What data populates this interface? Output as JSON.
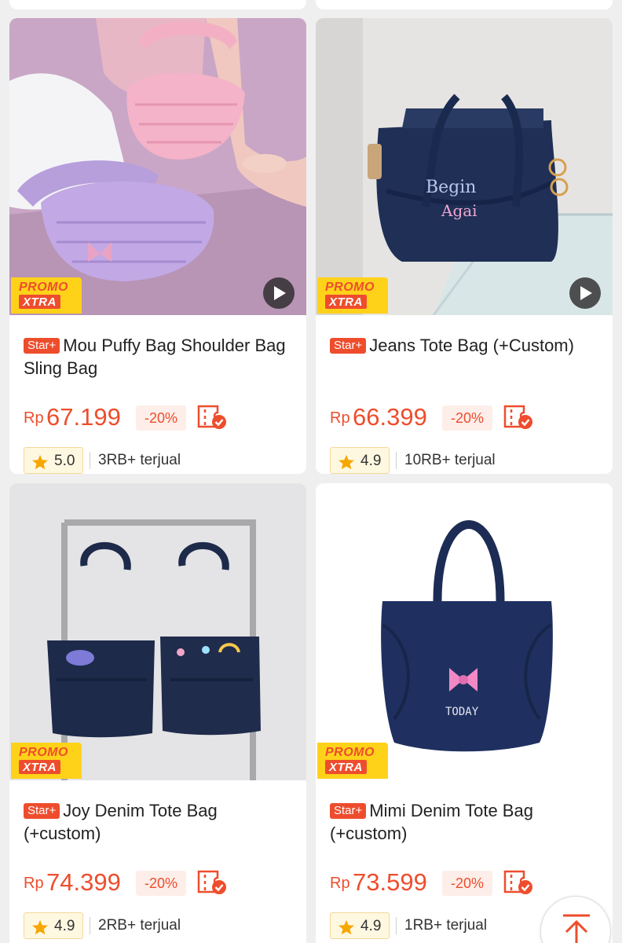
{
  "colors": {
    "accent": "#ee4d2d",
    "promo_yellow": "#ffd21a",
    "star": "#f6a700"
  },
  "products": [
    {
      "badge": "Star+",
      "name": "Mou Puffy Bag Shoulder Bag Sling Bag",
      "currency": "Rp",
      "price": "67.199",
      "discount": "-20%",
      "rating": "5.0",
      "sold": "3RB+ terjual",
      "promo_line1": "PROMO",
      "promo_line2": "XTRA",
      "has_video": true
    },
    {
      "badge": "Star+",
      "name": "Jeans Tote Bag (+Custom)",
      "currency": "Rp",
      "price": "66.399",
      "discount": "-20%",
      "rating": "4.9",
      "sold": "10RB+ terjual",
      "promo_line1": "PROMO",
      "promo_line2": "XTRA",
      "has_video": true,
      "print_line1": "Begin",
      "print_line2": "Agai"
    },
    {
      "badge": "Star+",
      "name": "Joy Denim Tote Bag (+custom)",
      "currency": "Rp",
      "price": "74.399",
      "discount": "-20%",
      "rating": "4.9",
      "sold": "2RB+ terjual",
      "promo_line1": "PROMO",
      "promo_line2": "XTRA",
      "has_video": false
    },
    {
      "badge": "Star+",
      "name": "Mimi Denim Tote Bag (+custom)",
      "currency": "Rp",
      "price": "73.599",
      "discount": "-20%",
      "rating": "4.9",
      "sold": "1RB+ terjual",
      "promo_line1": "PROMO",
      "promo_line2": "XTRA",
      "has_video": false,
      "print_line1": "TODAY"
    }
  ],
  "icons": {
    "play": "play-icon",
    "voucher": "voucher-check-icon",
    "star": "star-icon",
    "scroll_top": "arrow-up-icon"
  }
}
